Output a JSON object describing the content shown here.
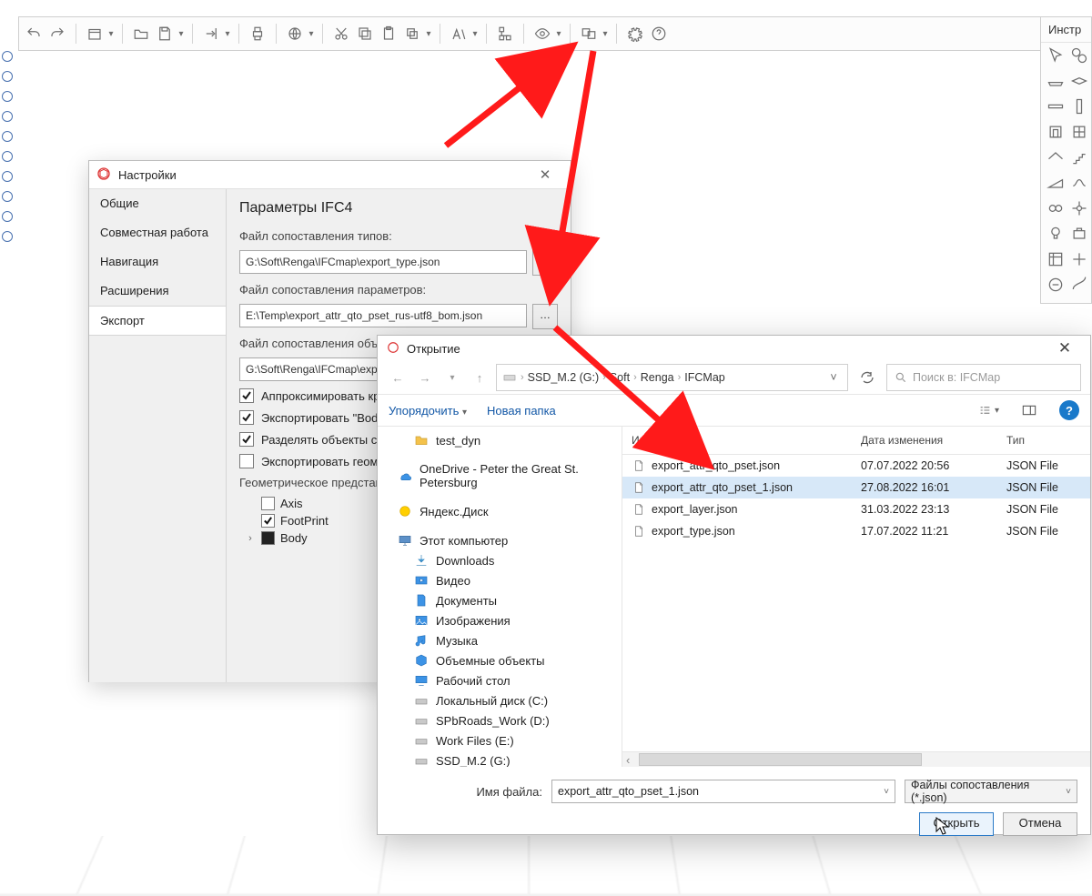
{
  "rpanel_title": "Инстр",
  "settings": {
    "title": "Настройки",
    "cats": [
      "Общие",
      "Совместная работа",
      "Навигация",
      "Расширения",
      "Экспорт"
    ],
    "selected": "Экспорт",
    "heading": "Параметры IFC4",
    "f_types_label": "Файл сопоставления типов:",
    "f_types_value": "G:\\Soft\\Renga\\IFCmap\\export_type.json",
    "f_params_label": "Файл сопоставления параметров:",
    "f_params_value": "E:\\Temp\\export_attr_qto_pset_rus-utf8_bom.json",
    "f_obj_label": "Файл сопоставления объект…",
    "f_obj_value": "G:\\Soft\\Renga\\IFCmap\\expor…",
    "chk_approx": "Аппроксимировать крив…",
    "chk_body": "Экспортировать \"Body\" п…",
    "chk_split": "Разделять объекты с мн…",
    "chk_geom": "Экспортировать геометр…",
    "geom_label": "Геометрическое представле…",
    "tree": {
      "axis": "Axis",
      "footprint": "FootPrint",
      "body": "Body"
    }
  },
  "fod": {
    "title": "Открытие",
    "crumbs": [
      "SSD_M.2 (G:)",
      "Soft",
      "Renga",
      "IFCMap"
    ],
    "search_placeholder": "Поиск в: IFCMap",
    "organize": "Упорядочить",
    "newfolder": "Новая папка",
    "cols": {
      "name": "Имя",
      "date": "Дата изменения",
      "type": "Тип"
    },
    "navpane": {
      "test_dyn": "test_dyn",
      "onedrive": "OneDrive - Peter the Great St. Petersburg",
      "yadisk": "Яндекс.Диск",
      "thispc": "Этот компьютер",
      "downloads": "Downloads",
      "video": "Видео",
      "docs": "Документы",
      "images": "Изображения",
      "music": "Музыка",
      "objects": "Объемные объекты",
      "desktop": "Рабочий стол",
      "drv_c": "Локальный диск (C:)",
      "drv_d": "SPbRoads_Work (D:)",
      "drv_e": "Work Files (E:)",
      "drv_g": "SSD_M.2 (G:)"
    },
    "files": [
      {
        "name": "export_attr_qto_pset.json",
        "date": "07.07.2022 20:56",
        "type": "JSON File"
      },
      {
        "name": "export_attr_qto_pset_1.json",
        "date": "27.08.2022 16:01",
        "type": "JSON File"
      },
      {
        "name": "export_layer.json",
        "date": "31.03.2022 23:13",
        "type": "JSON File"
      },
      {
        "name": "export_type.json",
        "date": "17.07.2022 11:21",
        "type": "JSON File"
      }
    ],
    "selected_index": 1,
    "fn_label": "Имя файла:",
    "fn_value": "export_attr_qto_pset_1.json",
    "filter": "Файлы сопоставления (*.json)",
    "open": "Открыть",
    "cancel": "Отмена"
  }
}
